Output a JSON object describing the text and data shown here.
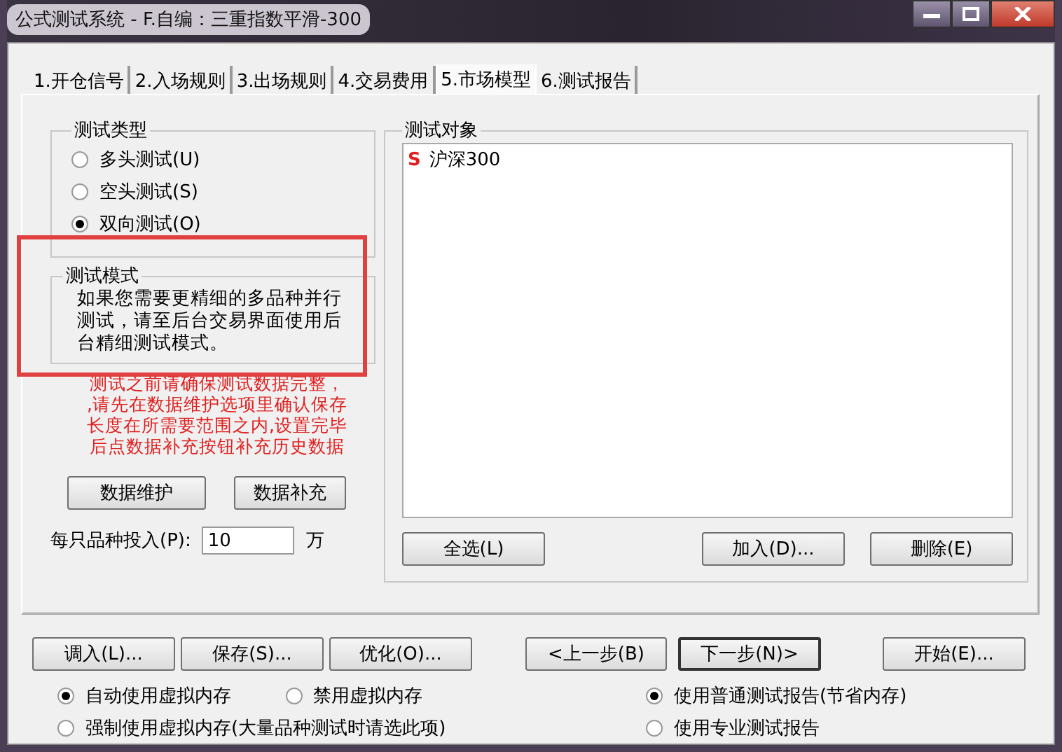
{
  "window": {
    "title": "公式测试系统 - F.自编：三重指数平滑-300"
  },
  "tabs": [
    {
      "label": "1.开仓信号",
      "selected": false
    },
    {
      "label": "2.入场规则",
      "selected": false
    },
    {
      "label": "3.出场规则",
      "selected": false
    },
    {
      "label": "4.交易费用",
      "selected": false
    },
    {
      "label": "5.市场模型",
      "selected": true
    },
    {
      "label": "6.测试报告",
      "selected": false
    }
  ],
  "test_type": {
    "title": "测试类型",
    "options": [
      {
        "label": "多头测试(U)",
        "selected": false
      },
      {
        "label": "空头测试(S)",
        "selected": false
      },
      {
        "label": "双向测试(O)",
        "selected": true
      }
    ]
  },
  "test_mode": {
    "title": "测试模式",
    "text": "如果您需要更精细的多品种并行测试，请至后台交易界面使用后台精细测试模式。"
  },
  "warning_lines": [
    "测试之前请确保测试数据完整，",
    ",请先在数据维护选项里确认保存",
    "长度在所需要范围之内,设置完毕",
    "后点数据补充按钮补充历史数据"
  ],
  "data_buttons": [
    "数据维护",
    "数据补充"
  ],
  "investment": {
    "label": "每只品种投入(P):",
    "value": "10",
    "unit": "万"
  },
  "test_objects": {
    "title": "测试对象",
    "items": [
      {
        "marker": "S",
        "name": "沪深300"
      }
    ],
    "buttons": [
      "全选(L)",
      "加入(D)...",
      "删除(E)"
    ]
  },
  "bottom_buttons": [
    "调入(L)...",
    "保存(S)...",
    "优化(O)...",
    "<上一步(B)",
    "下一步(N)>",
    "开始(E)..."
  ],
  "memory_options": [
    {
      "label": "自动使用虚拟内存",
      "selected": true
    },
    {
      "label": "禁用虚拟内存",
      "selected": false
    },
    {
      "label": "强制使用虚拟内存(大量品种测试时请选此项)",
      "selected": false
    }
  ],
  "report_options": [
    {
      "label": "使用普通测试报告(节省内存)",
      "selected": true
    },
    {
      "label": "使用专业测试报告",
      "selected": false
    }
  ]
}
